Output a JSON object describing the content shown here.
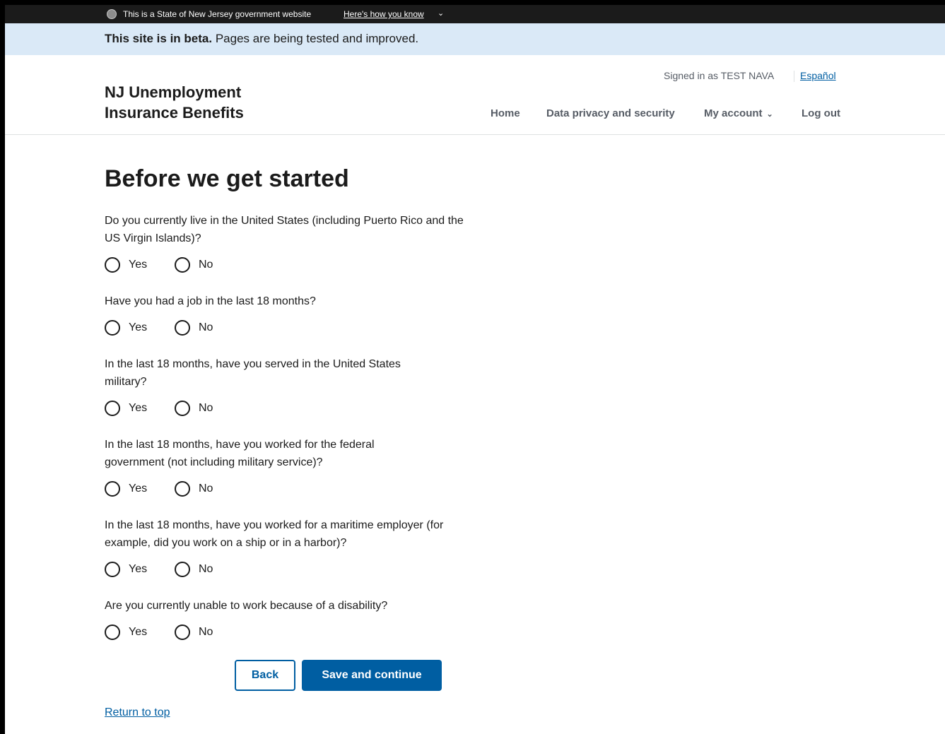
{
  "gov_banner": {
    "text": "This is a State of New Jersey government website",
    "link": "Here's how you know",
    "seal_icon": "nj-seal-icon",
    "chevron_icon": "chevron-down-icon"
  },
  "beta_banner": {
    "strong": "This site is in beta.",
    "text": " Pages are being tested and improved."
  },
  "header": {
    "title_line1": "NJ Unemployment",
    "title_line2": "Insurance Benefits",
    "signed_in": "Signed in as TEST NAVA",
    "language_link": "Español",
    "nav": {
      "home": "Home",
      "privacy": "Data privacy and security",
      "account": "My account",
      "logout": "Log out"
    }
  },
  "main": {
    "title": "Before we get started",
    "yes_label": "Yes",
    "no_label": "No",
    "questions": [
      {
        "label": "Do you currently live in the United States (including Puerto Rico and the US Virgin Islands)?"
      },
      {
        "label": "Have you had a job in the last 18 months?"
      },
      {
        "label": "In the last 18 months, have you served in the United States military?"
      },
      {
        "label": "In the last 18 months, have you worked for the federal government (not including military service)?"
      },
      {
        "label": "In the last 18 months, have you worked for a maritime employer (for example, did you work on a ship or in a harbor)?"
      },
      {
        "label": "Are you currently unable to work because of a disability?"
      }
    ],
    "back_button": "Back",
    "save_button": "Save and continue",
    "return_to_top": "Return to top"
  },
  "colors": {
    "primary": "#005ea2",
    "beta_bg": "#dae9f7",
    "gov_banner_bg": "#1b1b1b"
  }
}
